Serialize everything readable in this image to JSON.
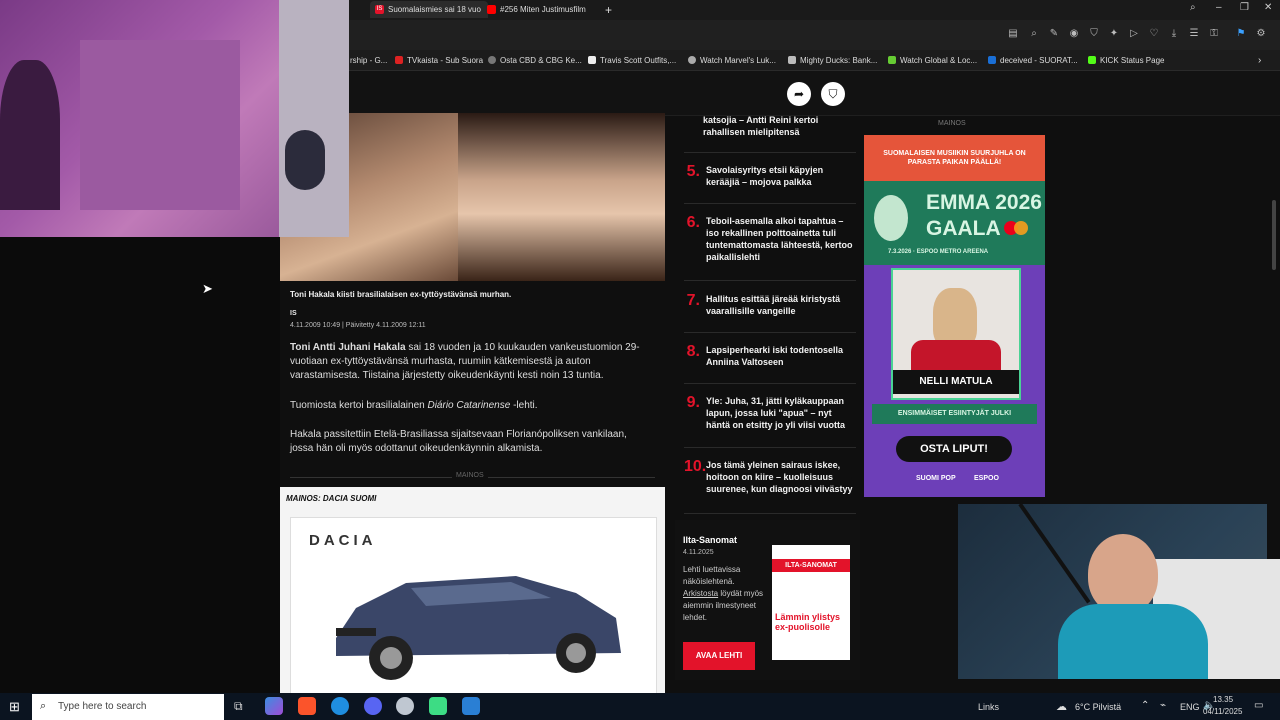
{
  "browser": {
    "tabs": [
      {
        "label": "Suomalaismies sai 18 vuo",
        "active": true,
        "icon": "is-icon"
      },
      {
        "label": "#256 Miten Justimusfilm",
        "active": false,
        "icon": "youtube-icon"
      }
    ],
    "bookmarks": [
      {
        "label": "rship - G...",
        "icon": "bookmark-icon"
      },
      {
        "label": "TVkaista - Sub Suora",
        "icon": "tv-icon"
      },
      {
        "label": "Osta CBD & CBG Ke...",
        "icon": "globe-icon"
      },
      {
        "label": "Travis Scott Outfits,...",
        "icon": "page-icon"
      },
      {
        "label": "Watch Marvel's Luk...",
        "icon": "stream-icon"
      },
      {
        "label": "Mighty Ducks: Bank...",
        "icon": "duck-icon"
      },
      {
        "label": "Watch Global & Loc...",
        "icon": "stream-icon"
      },
      {
        "label": "deceived - SUORAT...",
        "icon": "page-icon"
      },
      {
        "label": "KICK Status Page",
        "icon": "kick-icon"
      }
    ]
  },
  "article": {
    "caption": "Toni Hakala kiisti brasilialaisen ex-tyttöystävänsä murhan.",
    "caption_credit": "IS",
    "dateline": "4.11.2009 10:49 | Päivitetty 4.11.2009 12:11",
    "p1_name": "Toni Antti Juhani Hakala",
    "p1_rest": " sai 18 vuoden ja 10 kuukauden vankeustuomion 29-vuotiaan ex-tyttöystävänsä murhasta, ruumiin kätkemisestä ja auton varastamisesta. Tiistaina järjestetty oikeudenkäynti kesti noin 13 tuntia.",
    "p2_pre": "Tuomiosta kertoi brasilialainen ",
    "p2_em": "Diário Catarinense",
    "p2_post": " -lehti.",
    "p3": "Hakala passitettiin Etelä-Brasiliassa sijaitsevaan Florianópoliksen vankilaan, jossa hän oli myös odottanut oikeudenkäynnin alkamista.",
    "ad_divider": "MAINOS",
    "car_ad_label": "MAINOS: DACIA SUOMI",
    "car_brand": "DACIA"
  },
  "sidebar": {
    "top_partial": "katsojia – Antti Reini kertoi rahallisen mielipitensä",
    "items": [
      {
        "num": "5.",
        "text": "Savolaisyritys etsii käpyjen kerääjiä – mojova palkka"
      },
      {
        "num": "6.",
        "text": "Teboil-asemalla alkoi tapahtua – iso rekallinen polttoainetta tuli tuntemattomasta lähteestä, kertoo paikallislehti"
      },
      {
        "num": "7.",
        "text": "Hallitus esittää järeää kiristystä vaarallisille vangeille"
      },
      {
        "num": "8.",
        "text": "Lapsiperhearki iski todentosella Anniina Valtoseen"
      },
      {
        "num": "9.",
        "text": "Yle: Juha, 31, jätti kyläkauppaan lapun, jossa luki \"apua\" – nyt häntä on etsitty jo yli viisi vuotta"
      },
      {
        "num": "10.",
        "text": "Jos tämä yleinen sairaus iskee, hoitoon on kiire – kuolleisuus suurenee, kun diagnoosi viivästyy"
      }
    ],
    "promo": {
      "title": "Ilta-Sanomat",
      "date": "4.11.2025",
      "line1": "Lehti luettavissa näköislehtenä.",
      "link": "Arkistosta",
      "line2": " löydät myös aiemmin ilmestyneet lehdet.",
      "button": "AVAA LEHTI",
      "cover_title": "ILTA-SANOMAT",
      "cover_headline": "Lämmin ylistys ex-puolisolle"
    }
  },
  "emma_ad": {
    "mainos": "MAINOS",
    "banner": "SUOMALAISEN MUSIIKIN SUURJUHLA ON PARASTA PAIKAN PÄÄLLÄ!",
    "title1": "EMMA 2026",
    "title2": "GAALA",
    "date_venue": "7.3.2026 · ESPOO METRO AREENA",
    "artist": "NELLI MATULA",
    "subtitle": "ENSIMMÄISET ESIINTYJÄT JULKI",
    "cta": "OSTA LIPUT!",
    "logos_left": "SUOMI POP",
    "logos_right": "ESPOO"
  },
  "taskbar": {
    "search_placeholder": "Type here to search",
    "links": "Links",
    "weather": "6°C  Pilvistä",
    "lang": "ENG",
    "time": "13.35",
    "date": "04/11/2025"
  },
  "colors": {
    "accent_red": "#e3132a",
    "emma_purple": "#6d3fb8",
    "emma_green": "#2fa37a"
  }
}
